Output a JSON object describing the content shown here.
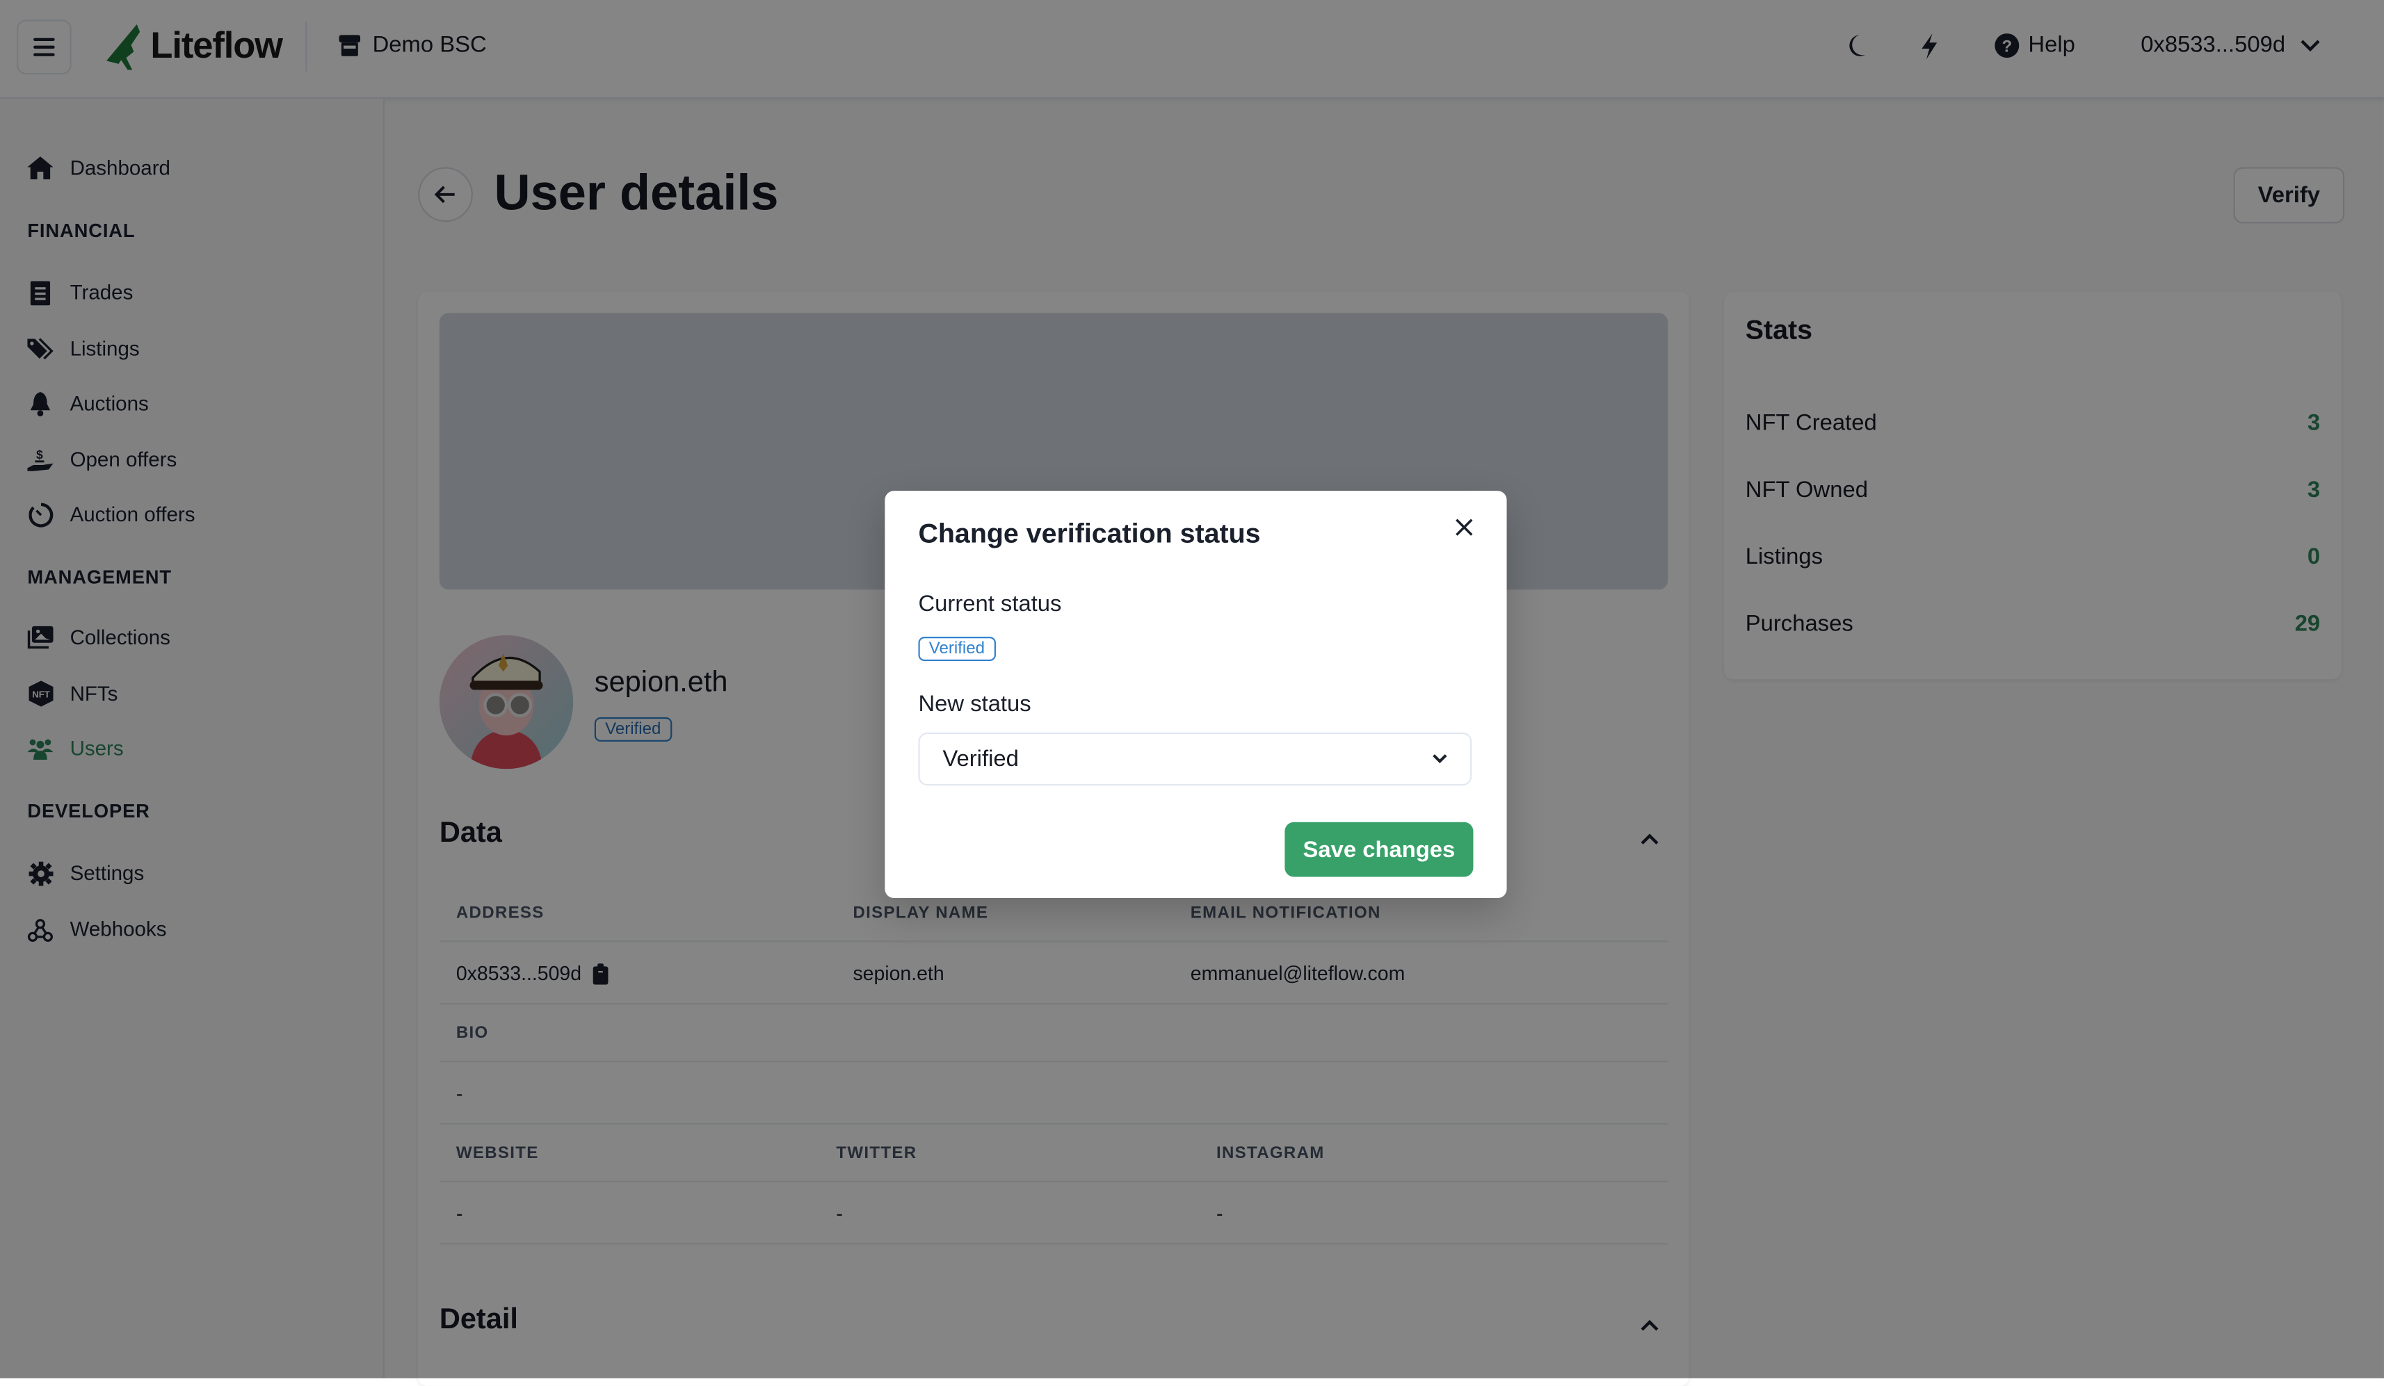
{
  "header": {
    "brand": "Liteflow",
    "store_name": "Demo BSC",
    "help_label": "Help",
    "account": "0x8533...509d",
    "brand_color": "#1f7a3a"
  },
  "sidebar": {
    "dashboard": "Dashboard",
    "sections": [
      {
        "title": "FINANCIAL",
        "items": [
          "Trades",
          "Listings",
          "Auctions",
          "Open offers",
          "Auction offers"
        ]
      },
      {
        "title": "MANAGEMENT",
        "items": [
          "Collections",
          "NFTs",
          "Users"
        ]
      },
      {
        "title": "DEVELOPER",
        "items": [
          "Settings",
          "Webhooks"
        ]
      }
    ],
    "active_item": "Users",
    "active_color": "#2f855a"
  },
  "page": {
    "title": "User details",
    "verify_label": "Verify"
  },
  "user": {
    "name": "sepion.eth",
    "status": "Verified"
  },
  "data_section": {
    "title": "Data",
    "headers_row1": [
      "ADDRESS",
      "DISPLAY NAME",
      "EMAIL NOTIFICATION"
    ],
    "values_row1": [
      "0x8533...509d",
      "sepion.eth",
      "emmanuel@liteflow.com"
    ],
    "bio_header": "BIO",
    "bio_value": "-",
    "headers_row2": [
      "WEBSITE",
      "TWITTER",
      "INSTAGRAM"
    ],
    "values_row2": [
      "-",
      "-",
      "-"
    ]
  },
  "detail_section": {
    "title": "Detail"
  },
  "stats": {
    "title": "Stats",
    "rows": [
      {
        "label": "NFT Created",
        "value": "3"
      },
      {
        "label": "NFT Owned",
        "value": "3"
      },
      {
        "label": "Listings",
        "value": "0"
      },
      {
        "label": "Purchases",
        "value": "29"
      }
    ]
  },
  "modal": {
    "title": "Change verification status",
    "current_label": "Current status",
    "current_value": "Verified",
    "new_label": "New status",
    "new_value": "Verified",
    "save_label": "Save changes",
    "save_color": "#38a169"
  }
}
